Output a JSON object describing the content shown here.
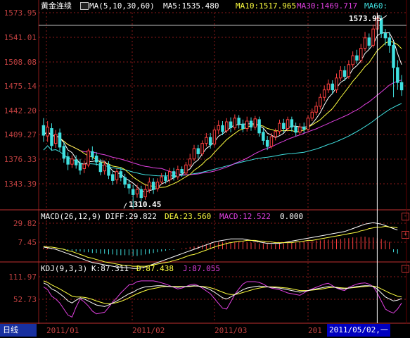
{
  "header": {
    "symbol": "黄金连续",
    "ma_icon": "ma-indicator-icon",
    "ma_params": "MA(5,10,30,60)",
    "ma5": "MA5:1535.480",
    "ma10": "MA10:1517.965",
    "ma30": "MA30:1469.717",
    "ma60": "MA60:"
  },
  "price_axis": [
    "1573.95",
    "1541.01",
    "1508.08",
    "1475.14",
    "1442.20",
    "1409.27",
    "1376.33",
    "1343.39"
  ],
  "price_annotations": {
    "high": "1573.95",
    "low": "1310.45"
  },
  "macd": {
    "title": "MACD(26,12,9)",
    "diff": "DIFF:29.822",
    "dea": "DEA:23.560",
    "macd": "MACD:12.522",
    "zero": "0.000",
    "axis": [
      "29.82",
      "7.45"
    ]
  },
  "kdj": {
    "title": "KDJ(9,3,3)",
    "k": "K:87.311",
    "d": "D:87.438",
    "j": "J:87.055",
    "axis": [
      "111.97",
      "52.73"
    ]
  },
  "footer": {
    "period": "日线",
    "months": [
      "2011/01",
      "2011/02",
      "2011/03",
      "201"
    ],
    "cursor_date": "2011/05/02,一"
  },
  "colors": {
    "up": "#ff4040",
    "down": "#40e0e0",
    "ma5": "#ffffff",
    "ma10": "#ffff40",
    "ma30": "#e040e0",
    "ma60": "#40e0e0",
    "grid": "#8b1a1a"
  },
  "chart_data": {
    "type": "candlestick",
    "y_range": [
      1310.45,
      1573.95
    ],
    "cursor_index": 82,
    "candles": [
      [
        1422,
        1409,
        1432,
        1400
      ],
      [
        1408,
        1420,
        1428,
        1400
      ],
      [
        1418,
        1395,
        1425,
        1388
      ],
      [
        1398,
        1410,
        1416,
        1392
      ],
      [
        1412,
        1393,
        1418,
        1388
      ],
      [
        1394,
        1378,
        1400,
        1372
      ],
      [
        1380,
        1370,
        1386,
        1362
      ],
      [
        1370,
        1377,
        1382,
        1365
      ],
      [
        1376,
        1369,
        1382,
        1364
      ],
      [
        1371,
        1362,
        1377,
        1356
      ],
      [
        1364,
        1370,
        1375,
        1358
      ],
      [
        1369,
        1388,
        1391,
        1366
      ],
      [
        1387,
        1380,
        1394,
        1376
      ],
      [
        1381,
        1373,
        1386,
        1368
      ],
      [
        1372,
        1360,
        1377,
        1355
      ],
      [
        1361,
        1369,
        1374,
        1356
      ],
      [
        1369,
        1355,
        1374,
        1350
      ],
      [
        1356,
        1348,
        1361,
        1342
      ],
      [
        1349,
        1360,
        1364,
        1344
      ],
      [
        1360,
        1352,
        1366,
        1347
      ],
      [
        1352,
        1343,
        1357,
        1338
      ],
      [
        1343,
        1338,
        1349,
        1330
      ],
      [
        1336,
        1329,
        1342,
        1310
      ],
      [
        1330,
        1336,
        1342,
        1325
      ],
      [
        1336,
        1325,
        1341,
        1320
      ],
      [
        1326,
        1336,
        1342,
        1322
      ],
      [
        1336,
        1346,
        1352,
        1331
      ],
      [
        1346,
        1336,
        1351,
        1330
      ],
      [
        1337,
        1346,
        1351,
        1333
      ],
      [
        1346,
        1353,
        1358,
        1343
      ],
      [
        1353,
        1348,
        1359,
        1344
      ],
      [
        1349,
        1360,
        1365,
        1345
      ],
      [
        1360,
        1352,
        1365,
        1348
      ],
      [
        1353,
        1363,
        1368,
        1349
      ],
      [
        1363,
        1358,
        1367,
        1353
      ],
      [
        1358,
        1369,
        1373,
        1355
      ],
      [
        1369,
        1377,
        1384,
        1366
      ],
      [
        1377,
        1391,
        1396,
        1374
      ],
      [
        1391,
        1384,
        1396,
        1378
      ],
      [
        1384,
        1398,
        1402,
        1381
      ],
      [
        1398,
        1406,
        1412,
        1394
      ],
      [
        1406,
        1396,
        1412,
        1391
      ],
      [
        1397,
        1416,
        1420,
        1394
      ],
      [
        1416,
        1422,
        1429,
        1411
      ],
      [
        1422,
        1414,
        1428,
        1409
      ],
      [
        1415,
        1427,
        1432,
        1412
      ],
      [
        1427,
        1419,
        1433,
        1413
      ],
      [
        1419,
        1432,
        1437,
        1416
      ],
      [
        1432,
        1424,
        1436,
        1418
      ],
      [
        1424,
        1418,
        1430,
        1413
      ],
      [
        1418,
        1428,
        1434,
        1414
      ],
      [
        1428,
        1420,
        1433,
        1415
      ],
      [
        1420,
        1431,
        1435,
        1416
      ],
      [
        1430,
        1412,
        1434,
        1407
      ],
      [
        1413,
        1402,
        1418,
        1396
      ],
      [
        1402,
        1394,
        1408,
        1389
      ],
      [
        1394,
        1407,
        1412,
        1391
      ],
      [
        1407,
        1414,
        1418,
        1402
      ],
      [
        1414,
        1425,
        1430,
        1410
      ],
      [
        1425,
        1418,
        1431,
        1412
      ],
      [
        1418,
        1430,
        1434,
        1414
      ],
      [
        1430,
        1420,
        1434,
        1414
      ],
      [
        1420,
        1413,
        1426,
        1408
      ],
      [
        1413,
        1420,
        1425,
        1409
      ],
      [
        1420,
        1417,
        1426,
        1412
      ],
      [
        1417,
        1432,
        1436,
        1414
      ],
      [
        1432,
        1440,
        1445,
        1428
      ],
      [
        1440,
        1448,
        1454,
        1436
      ],
      [
        1448,
        1460,
        1465,
        1444
      ],
      [
        1460,
        1470,
        1476,
        1455
      ],
      [
        1470,
        1478,
        1484,
        1466
      ],
      [
        1478,
        1470,
        1483,
        1464
      ],
      [
        1470,
        1486,
        1492,
        1466
      ],
      [
        1486,
        1496,
        1502,
        1482
      ],
      [
        1496,
        1488,
        1502,
        1482
      ],
      [
        1488,
        1504,
        1510,
        1485
      ],
      [
        1504,
        1516,
        1522,
        1500
      ],
      [
        1516,
        1510,
        1524,
        1505
      ],
      [
        1510,
        1526,
        1532,
        1506
      ],
      [
        1526,
        1540,
        1548,
        1522
      ],
      [
        1540,
        1530,
        1546,
        1525
      ],
      [
        1530,
        1552,
        1558,
        1527
      ],
      [
        1552,
        1566,
        1574,
        1548
      ],
      [
        1566,
        1546,
        1570,
        1540
      ],
      [
        1546,
        1540,
        1552,
        1530
      ],
      [
        1540,
        1530,
        1548,
        1520
      ],
      [
        1530,
        1500,
        1535,
        1460
      ],
      [
        1500,
        1480,
        1510,
        1470
      ],
      [
        1480,
        1470,
        1490,
        1462
      ]
    ],
    "macd_bars": [
      2,
      2,
      1,
      1,
      0,
      -1,
      -2,
      -2,
      -3,
      -3,
      -4,
      -4,
      -5,
      -5,
      -6,
      -6,
      -7,
      -7,
      -8,
      -8,
      -8,
      -8,
      -9,
      -9,
      -8,
      -7,
      -6,
      -5,
      -4,
      -3,
      -2,
      -1,
      -1,
      0,
      1,
      2,
      3,
      4,
      5,
      6,
      7,
      8,
      8,
      9,
      9,
      9,
      10,
      10,
      10,
      10,
      9,
      9,
      9,
      8,
      8,
      7,
      7,
      7,
      8,
      8,
      9,
      9,
      9,
      10,
      10,
      11,
      11,
      12,
      12,
      13,
      13,
      13,
      14,
      14,
      15,
      15,
      16,
      16,
      17,
      17,
      16,
      16,
      15,
      14,
      12,
      10,
      -4,
      -6
    ],
    "macd_diff": [
      3,
      2,
      1,
      0,
      -2,
      -4,
      -6,
      -8,
      -10,
      -12,
      -14,
      -16,
      -18,
      -19,
      -20,
      -21,
      -22,
      -23,
      -24,
      -24,
      -25,
      -25,
      -26,
      -26,
      -25,
      -24,
      -22,
      -20,
      -18,
      -16,
      -14,
      -12,
      -10,
      -8,
      -6,
      -4,
      -2,
      0,
      2,
      4,
      6,
      8,
      10,
      11,
      12,
      13,
      14,
      14,
      14,
      14,
      13,
      12,
      11,
      10,
      9,
      8,
      8,
      8,
      8,
      9,
      10,
      11,
      12,
      13,
      14,
      15,
      16,
      17,
      18,
      19,
      20,
      21,
      22,
      23,
      24,
      26,
      28,
      30,
      32,
      34,
      35,
      36,
      35,
      34,
      32,
      30,
      28,
      26
    ],
    "macd_dea": [
      4,
      3,
      3,
      2,
      1,
      0,
      -2,
      -3,
      -5,
      -7,
      -9,
      -11,
      -12,
      -14,
      -15,
      -17,
      -18,
      -19,
      -20,
      -21,
      -22,
      -22,
      -23,
      -23,
      -23,
      -23,
      -22,
      -21,
      -20,
      -19,
      -18,
      -17,
      -15,
      -14,
      -12,
      -10,
      -8,
      -7,
      -5,
      -3,
      -1,
      1,
      3,
      5,
      6,
      8,
      9,
      10,
      11,
      11,
      12,
      12,
      12,
      11,
      11,
      10,
      10,
      9,
      9,
      9,
      9,
      9,
      10,
      10,
      11,
      12,
      12,
      13,
      14,
      15,
      16,
      17,
      18,
      19,
      20,
      21,
      22,
      23,
      25,
      26,
      28,
      29,
      30,
      30,
      31,
      30,
      30,
      29
    ],
    "kdj_k": [
      95,
      90,
      80,
      75,
      68,
      60,
      50,
      45,
      52,
      58,
      55,
      50,
      45,
      40,
      38,
      36,
      40,
      45,
      50,
      56,
      62,
      68,
      72,
      78,
      82,
      85,
      86,
      87,
      88,
      88,
      87,
      86,
      85,
      84,
      85,
      86,
      87,
      88,
      87,
      85,
      82,
      78,
      72,
      65,
      58,
      55,
      60,
      66,
      72,
      78,
      82,
      84,
      86,
      87,
      86,
      85,
      84,
      83,
      82,
      80,
      78,
      76,
      74,
      72,
      74,
      76,
      78,
      80,
      82,
      84,
      86,
      85,
      83,
      81,
      80,
      82,
      84,
      86,
      87,
      88,
      88,
      86,
      80,
      70,
      60,
      55,
      50,
      52,
      56
    ],
    "kdj_d": [
      100,
      96,
      90,
      85,
      80,
      74,
      68,
      62,
      60,
      60,
      59,
      57,
      54,
      50,
      47,
      44,
      43,
      44,
      46,
      49,
      53,
      58,
      63,
      68,
      72,
      76,
      79,
      81,
      83,
      85,
      86,
      86,
      86,
      86,
      86,
      86,
      86,
      87,
      87,
      86,
      85,
      83,
      80,
      76,
      72,
      68,
      66,
      66,
      68,
      71,
      74,
      77,
      80,
      82,
      84,
      85,
      85,
      85,
      84,
      83,
      82,
      80,
      78,
      76,
      76,
      76,
      77,
      78,
      79,
      81,
      83,
      84,
      84,
      83,
      82,
      82,
      83,
      84,
      85,
      86,
      87,
      87,
      85,
      80,
      75,
      70,
      66,
      62,
      60
    ],
    "kdj_j": [
      85,
      78,
      62,
      55,
      45,
      30,
      15,
      10,
      35,
      55,
      48,
      38,
      25,
      18,
      20,
      22,
      34,
      48,
      58,
      70,
      80,
      90,
      92,
      98,
      100,
      100,
      100,
      100,
      98,
      95,
      92,
      88,
      84,
      80,
      82,
      86,
      90,
      92,
      88,
      82,
      75,
      68,
      56,
      44,
      32,
      30,
      48,
      66,
      80,
      92,
      98,
      98,
      98,
      96,
      92,
      86,
      82,
      80,
      78,
      74,
      70,
      68,
      66,
      64,
      70,
      76,
      80,
      84,
      88,
      92,
      94,
      88,
      82,
      78,
      76,
      84,
      88,
      92,
      94,
      95,
      92,
      86,
      70,
      50,
      30,
      24,
      20,
      30,
      45
    ]
  }
}
